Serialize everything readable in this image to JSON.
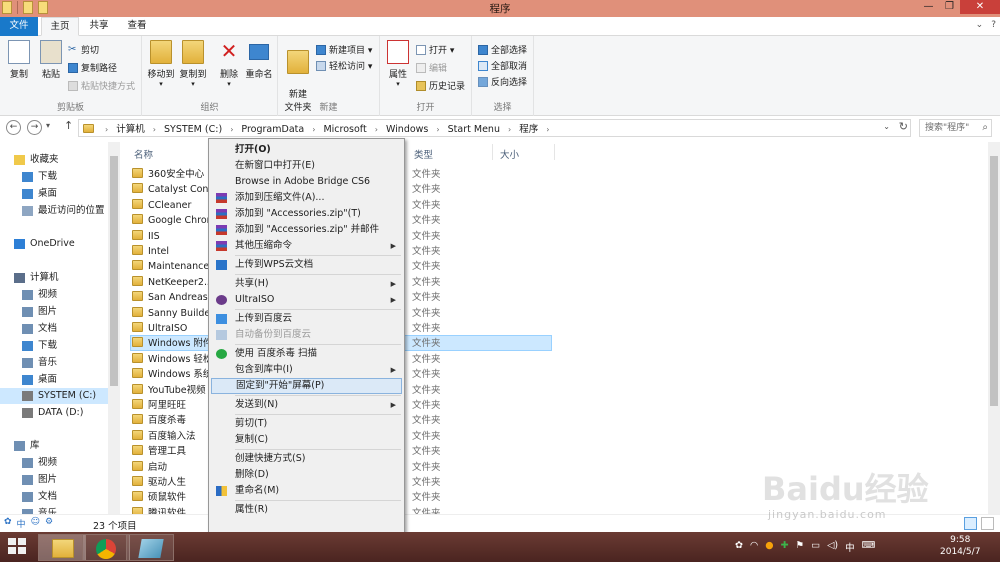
{
  "window": {
    "title": "程序",
    "controls": [
      "—",
      "❐",
      "✕"
    ]
  },
  "ribbon_tabs": {
    "file": "文件",
    "home": "主页",
    "share": "共享",
    "view": "查看"
  },
  "ribbon": {
    "clipboard": {
      "copy": "复制",
      "paste": "粘贴",
      "cut": "剪切",
      "copy_path": "复制路径",
      "paste_shortcut": "粘贴快捷方式",
      "label": "剪贴板"
    },
    "organize": {
      "move_to": "移动到",
      "copy_to": "复制到",
      "delete": "删除",
      "rename": "重命名",
      "label": "组织"
    },
    "new": {
      "new_folder": "新建\n文件夹",
      "new_item": "新建项目 ▾",
      "easy_access": "轻松访问 ▾",
      "label": "新建"
    },
    "open": {
      "properties": "属性",
      "open": "打开 ▾",
      "edit": "编辑",
      "history": "历史记录",
      "label": "打开"
    },
    "select": {
      "select_all": "全部选择",
      "select_none": "全部取消",
      "invert": "反向选择",
      "label": "选择"
    }
  },
  "address": {
    "crumbs": [
      "计算机",
      "SYSTEM (C:)",
      "ProgramData",
      "Microsoft",
      "Windows",
      "Start Menu",
      "程序"
    ],
    "search_placeholder": "搜索\"程序\""
  },
  "navpane": {
    "items": [
      {
        "label": "收藏夹",
        "indent": 0
      },
      {
        "label": "下载",
        "indent": 1
      },
      {
        "label": "桌面",
        "indent": 1
      },
      {
        "label": "最近访问的位置",
        "indent": 1
      },
      {
        "label": "OneDrive",
        "indent": 0
      },
      {
        "label": "计算机",
        "indent": 0
      },
      {
        "label": "视频",
        "indent": 1
      },
      {
        "label": "图片",
        "indent": 1
      },
      {
        "label": "文档",
        "indent": 1
      },
      {
        "label": "下载",
        "indent": 1
      },
      {
        "label": "音乐",
        "indent": 1
      },
      {
        "label": "桌面",
        "indent": 1
      },
      {
        "label": "SYSTEM (C:)",
        "indent": 1
      },
      {
        "label": "DATA (D:)",
        "indent": 1
      },
      {
        "label": "库",
        "indent": 0
      },
      {
        "label": "视频",
        "indent": 1
      },
      {
        "label": "图片",
        "indent": 1
      },
      {
        "label": "文档",
        "indent": 1
      },
      {
        "label": "音乐",
        "indent": 1
      }
    ]
  },
  "filelist": {
    "columns": {
      "name": "名称",
      "type": "类型",
      "size": "大小"
    },
    "files": [
      "360安全中心",
      "Catalyst Contr",
      "CCleaner",
      "Google Chron",
      "IIS",
      "Intel",
      "Maintenance",
      "NetKeeper2.5",
      "San Andreas M",
      "Sanny Builder",
      "UltraISO",
      "Windows 附件",
      "Windows 轻松",
      "Windows 系统",
      "YouTube视频",
      "阿里旺旺",
      "百度杀毒",
      "百度输入法",
      "管理工具",
      "启动",
      "驱动人生",
      "硕鼠软件",
      "腾讯软件"
    ],
    "type_value": "文件夹"
  },
  "statusbar": {
    "count": "23 个项目"
  },
  "context_menu": {
    "items": [
      {
        "label": "打开(O)",
        "bold": true
      },
      {
        "label": "在新窗口中打开(E)"
      },
      {
        "label": "Browse in Adobe Bridge CS6"
      },
      {
        "label": "添加到压缩文件(A)...",
        "icon": "rar"
      },
      {
        "label": "添加到 \"Accessories.zip\"(T)",
        "icon": "rar"
      },
      {
        "label": "添加到 \"Accessories.zip\" 并邮件",
        "icon": "rar"
      },
      {
        "label": "其他压缩命令",
        "icon": "rar",
        "sub": true
      },
      {
        "sep": true
      },
      {
        "label": "上传到WPS云文档",
        "icon": "wps"
      },
      {
        "sep": true
      },
      {
        "label": "共享(H)",
        "sub": true
      },
      {
        "label": "UltraISO",
        "icon": "iso",
        "sub": true
      },
      {
        "sep": true
      },
      {
        "label": "上传到百度云",
        "icon": "baidu"
      },
      {
        "label": "自动备份到百度云",
        "icon": "baidu2",
        "disabled": true
      },
      {
        "sep": true
      },
      {
        "label": "使用 百度杀毒 扫描",
        "icon": "av"
      },
      {
        "label": "包含到库中(I)",
        "sub": true
      },
      {
        "label": "固定到\"开始\"屏幕(P)",
        "highlight": true
      },
      {
        "sep": true
      },
      {
        "label": "发送到(N)",
        "sub": true
      },
      {
        "sep": true
      },
      {
        "label": "剪切(T)"
      },
      {
        "label": "复制(C)"
      },
      {
        "sep": true
      },
      {
        "label": "创建快捷方式(S)"
      },
      {
        "label": "删除(D)"
      },
      {
        "label": "重命名(M)",
        "icon": "shield"
      },
      {
        "sep": true
      },
      {
        "label": "属性(R)"
      }
    ]
  },
  "taskbar": {
    "clock_time": "9:58",
    "clock_date": "2014/5/7",
    "ime": "中"
  },
  "watermark": {
    "logo": "Baidu经验",
    "sub": "jingyan.baidu.com"
  },
  "colors": {
    "titlebar": "#e0907a",
    "file_tab": "#1979ca",
    "selection": "#cce8ff",
    "taskbar": "#4a2420"
  }
}
